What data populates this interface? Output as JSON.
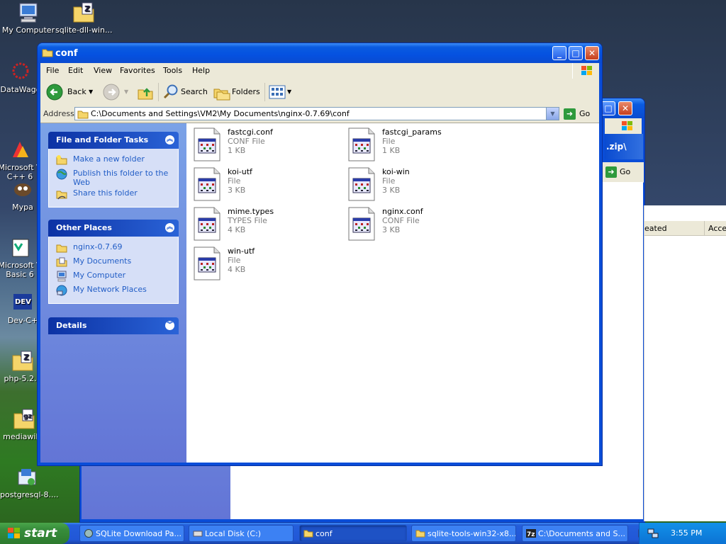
{
  "desktop": {
    "icons": [
      {
        "label": "My Computer"
      },
      {
        "label": "sqlite-dll-win..."
      },
      {
        "label": "DataWago"
      },
      {
        "label": "Microsoft V\nC++ 6"
      },
      {
        "label": "Mypa"
      },
      {
        "label": "Microsoft V\nBasic 6"
      },
      {
        "label": "Dev-C+"
      },
      {
        "label": "php-5.2.1"
      },
      {
        "label": "mediawiki-"
      },
      {
        "label": "postgresql-8...."
      }
    ]
  },
  "back_window": {
    "title_fragment": ".zip\\",
    "go_label": "Go",
    "col_created": "eated",
    "col_access": "Acces"
  },
  "window": {
    "title": "conf",
    "menu": [
      "File",
      "Edit",
      "View",
      "Favorites",
      "Tools",
      "Help"
    ],
    "toolbar": {
      "back": "Back",
      "search": "Search",
      "folders": "Folders"
    },
    "address": {
      "label": "Address",
      "value": "C:\\Documents and Settings\\VM2\\My Documents\\nginx-0.7.69\\conf",
      "go": "Go"
    },
    "tasks_panel": {
      "title": "File and Folder Tasks",
      "items": [
        "Make a new folder",
        "Publish this folder to the Web",
        "Share this folder"
      ]
    },
    "places_panel": {
      "title": "Other Places",
      "items": [
        "nginx-0.7.69",
        "My Documents",
        "My Computer",
        "My Network Places"
      ]
    },
    "details_panel": {
      "title": "Details"
    },
    "files": [
      {
        "name": "fastcgi.conf",
        "type": "CONF File",
        "size": "1 KB"
      },
      {
        "name": "fastcgi_params",
        "type": "File",
        "size": "1 KB"
      },
      {
        "name": "koi-utf",
        "type": "File",
        "size": "3 KB"
      },
      {
        "name": "koi-win",
        "type": "File",
        "size": "3 KB"
      },
      {
        "name": "mime.types",
        "type": "TYPES File",
        "size": "4 KB"
      },
      {
        "name": "nginx.conf",
        "type": "CONF File",
        "size": "3 KB"
      },
      {
        "name": "win-utf",
        "type": "File",
        "size": "4 KB"
      }
    ]
  },
  "taskbar": {
    "start": "start",
    "buttons": [
      {
        "label": "SQLite Download Pa..."
      },
      {
        "label": "Local Disk (C:)"
      },
      {
        "label": "conf"
      },
      {
        "label": "sqlite-tools-win32-x8..."
      },
      {
        "label": "C:\\Documents and S..."
      }
    ],
    "clock": "3:55 PM"
  }
}
